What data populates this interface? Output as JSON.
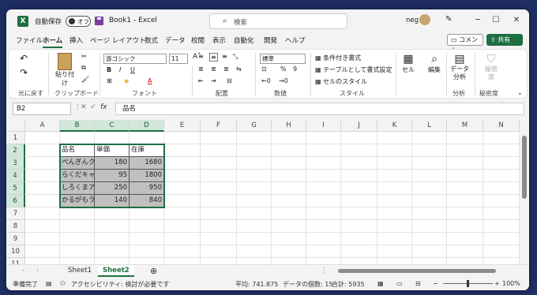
{
  "title_bar": {
    "app_icon": "X",
    "autosave_label": "自動保存",
    "autosave_state": "オフ",
    "doc_title": "Book1  -  Excel",
    "search_placeholder": "検索",
    "user_name": "neg",
    "window_controls": [
      "─",
      "☐",
      "✕"
    ]
  },
  "ribbon_tabs": [
    "ファイル",
    "ホーム",
    "挿入",
    "ページ レイアウト",
    "数式",
    "データ",
    "校閲",
    "表示",
    "自動化",
    "開発",
    "ヘルプ"
  ],
  "active_tab": "ホーム",
  "header_buttons": {
    "comment": "コメント",
    "share": "共有"
  },
  "ribbon": {
    "undo_group": "元に戻す",
    "clipboard_group": "クリップボード",
    "paste_label": "貼り付け",
    "font_group": "フォント",
    "font_name": "游ゴシック",
    "font_size": "11",
    "align_group": "配置",
    "number_group": "数値",
    "number_format": "標準",
    "style_group": "スタイル",
    "cond_format": "条件付き書式",
    "table_format": "テーブルとして書式設定",
    "cell_style": "セルのスタイル",
    "cells_label": "セル",
    "editing_label": "編集",
    "analysis_group": "分析",
    "analysis_label": "データ分析",
    "sensitivity_group": "秘密度",
    "sensitivity_label": "秘密度"
  },
  "formula_bar": {
    "name_box": "B2",
    "fx": "fx",
    "content": "品名"
  },
  "columns": [
    "A",
    "B",
    "C",
    "D",
    "E",
    "F",
    "G",
    "H",
    "I",
    "J",
    "K",
    "L",
    "M",
    "N"
  ],
  "rows": [
    "1",
    "2",
    "3",
    "4",
    "5",
    "6",
    "7",
    "8",
    "9",
    "10",
    "11"
  ],
  "table": {
    "headers": [
      "品名",
      "単価",
      "在庫"
    ],
    "rows": [
      [
        "ぺんぎんクッキー",
        "180",
        "1680"
      ],
      [
        "らくだキャンディ",
        "95",
        "1800"
      ],
      [
        "しろくまアイス",
        "250",
        "950"
      ],
      [
        "かるがもラムネ",
        "140",
        "840"
      ]
    ]
  },
  "sheets": [
    "Sheet1",
    "Sheet2"
  ],
  "active_sheet": "Sheet2",
  "status_bar": {
    "ready": "準備完了",
    "accessibility": "アクセシビリティ: 検討が必要です",
    "average": "平均: 741.875",
    "count": "データの個数: 15",
    "sum": "合計: 5935",
    "zoom": "100%"
  }
}
